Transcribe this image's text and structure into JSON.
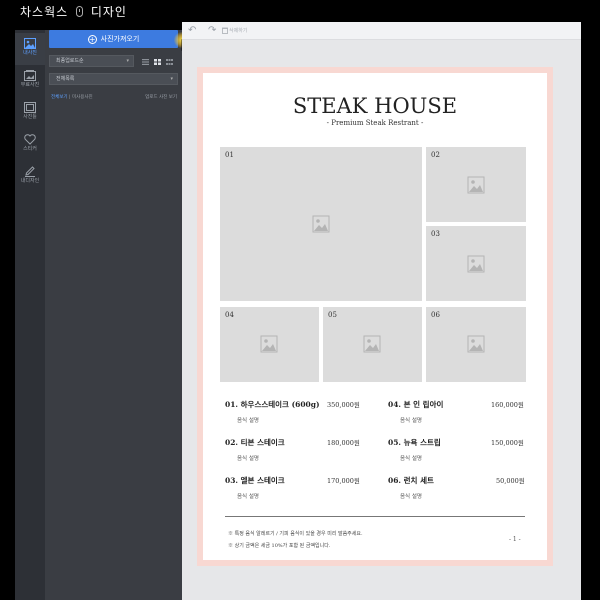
{
  "app": {
    "title_left": "차스웍스",
    "title_right": "디자인"
  },
  "rail": {
    "items": [
      {
        "label": "내사진"
      },
      {
        "label": "무료사진"
      },
      {
        "label": "사진틀"
      },
      {
        "label": "스티커"
      },
      {
        "label": "내디자인"
      }
    ]
  },
  "panel": {
    "upload_label": "사진가져오기",
    "sort_select": "최종업로드순",
    "folder_select": "전체목록",
    "filter_all": "전체보기",
    "filter_sep": "|",
    "filter_unused": "미사용사진",
    "filter_right": "업로드 사진 보기"
  },
  "toolbar": {
    "delete_label": "삭제하기"
  },
  "document": {
    "title": "STEAK HOUSE",
    "subtitle": "- Premium Steak Restrant -",
    "photos": [
      {
        "num": "01"
      },
      {
        "num": "02"
      },
      {
        "num": "03"
      },
      {
        "num": "04"
      },
      {
        "num": "05"
      },
      {
        "num": "06"
      }
    ],
    "menu": [
      {
        "name": "01. 하우스스테이크 (600g)",
        "desc": "음식 설명",
        "price": "350,000원"
      },
      {
        "name": "02. 티본 스테이크",
        "desc": "음식 설명",
        "price": "180,000원"
      },
      {
        "name": "03. 엘본 스테이크",
        "desc": "음식 설명",
        "price": "170,000원"
      },
      {
        "name": "04. 본 인 립아이",
        "desc": "음식 설명",
        "price": "160,000원"
      },
      {
        "name": "05. 뉴욕 스트립",
        "desc": "음식 설명",
        "price": "150,000원"
      },
      {
        "name": "06. 런치 세트",
        "desc": "음식 설명",
        "price": "50,000원"
      }
    ],
    "footnote_1": "※ 특정 음식 알레르기 / 기피 음식이 있을 경우 미리 말씀주세요.",
    "footnote_2": "※ 상기 금액은 세금 10%가 포함 된 금액입니다.",
    "page_number": "- 1 -"
  },
  "colors": {
    "accent": "#3d7be0",
    "sheet_border": "#f8d8d2",
    "placeholder": "#dcdcdc"
  }
}
